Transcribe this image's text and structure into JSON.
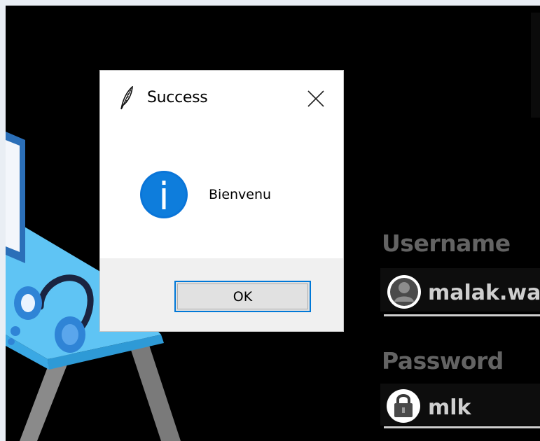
{
  "login_form": {
    "username_label": "Username",
    "username_value": "malak.wa",
    "password_label": "Password",
    "password_value": "mlk",
    "user_icon": "user-avatar-icon",
    "lock_icon": "padlock-icon"
  },
  "dialog": {
    "title": "Success",
    "app_icon": "feather-icon",
    "close_icon": "close-icon",
    "message_icon": "info-icon",
    "message": "Bienvenu",
    "ok_label": "OK"
  },
  "colors": {
    "background": "#000000",
    "field_text": "#cfcfcf",
    "label_text": "#636363",
    "info_blue": "#0a75d8",
    "ok_focus": "#0078d7",
    "illustration_blue": "#4fc3f7"
  }
}
